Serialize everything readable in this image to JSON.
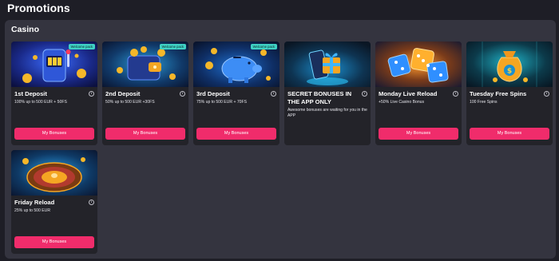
{
  "page": {
    "title": "Promotions"
  },
  "section": {
    "title": "Casino"
  },
  "badge_label": "Welcome pack",
  "colors": {
    "accent": "#f02c6b",
    "badge": "#3fd1c5",
    "card": "#232329",
    "panel": "#34343f",
    "background": "#1e1e26"
  },
  "cards": [
    {
      "title": "1st Deposit",
      "description": "100% up to 500 EUR + 50FS",
      "button": "My Bonuses",
      "badge": true,
      "image": "slot-machine-image"
    },
    {
      "title": "2nd Deposit",
      "description": "50% up to 500 EUR +30FS",
      "button": "My Bonuses",
      "badge": true,
      "image": "wallet-coins-image"
    },
    {
      "title": "3rd Deposit",
      "description": "75% up to 500 EUR + 70FS",
      "button": "My Bonuses",
      "badge": true,
      "image": "piggy-bank-image"
    },
    {
      "title": "SECRET BONUSES IN THE APP ONLY",
      "description": "Awesome bonuses are waiting for you in the APP",
      "button": "",
      "badge": false,
      "image": "phone-gift-image"
    },
    {
      "title": "Monday Live Reload",
      "description": "+50% Live Casino Bonus",
      "button": "My Bonuses",
      "badge": false,
      "image": "dice-image"
    },
    {
      "title": "Tuesday Free Spins",
      "description": "100 Free Spins",
      "button": "My Bonuses",
      "badge": false,
      "image": "money-bag-image"
    },
    {
      "title": "Friday Reload",
      "description": "25% up to 500 EUR",
      "button": "My Bonuses",
      "badge": false,
      "image": "roulette-image"
    }
  ]
}
